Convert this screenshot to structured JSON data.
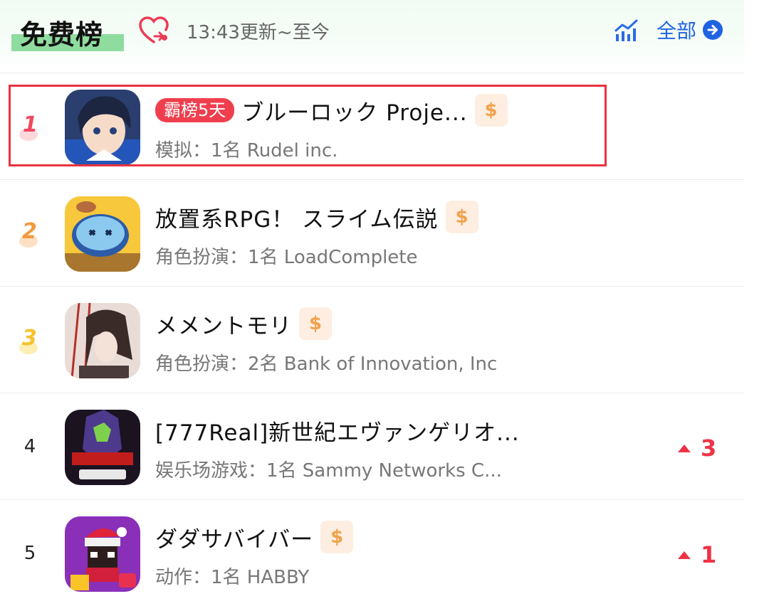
{
  "header": {
    "title": "免费榜",
    "update_text": "13:43更新~至今",
    "all_label": "全部"
  },
  "colors": {
    "accent_blue": "#1f63e3",
    "rank_up_red": "#ee3347",
    "badge_red": "#ef3f4e",
    "title_highlight_green": "#8fdc9f"
  },
  "rows": [
    {
      "rank": "1",
      "badge": "霸榜5天",
      "name": "ブルーロック Proje...",
      "paid": "$",
      "meta": "模拟：1名 Rudel inc.",
      "change": ""
    },
    {
      "rank": "2",
      "badge": "",
      "name": "放置系RPG！ スライム伝説",
      "paid": "$",
      "meta": "角色扮演：1名 LoadComplete",
      "change": ""
    },
    {
      "rank": "3",
      "badge": "",
      "name": "メメントモリ",
      "paid": "$",
      "meta": "角色扮演：2名 Bank of Innovation, Inc",
      "change": ""
    },
    {
      "rank": "4",
      "badge": "",
      "name": "[777Real]新世紀エヴァンゲリオ...",
      "paid": "",
      "meta": "娱乐场游戏：1名 Sammy Networks C...",
      "change": "3"
    },
    {
      "rank": "5",
      "badge": "",
      "name": "ダダサバイバー",
      "paid": "$",
      "meta": "动作：1名 HABBY",
      "change": "1"
    }
  ]
}
